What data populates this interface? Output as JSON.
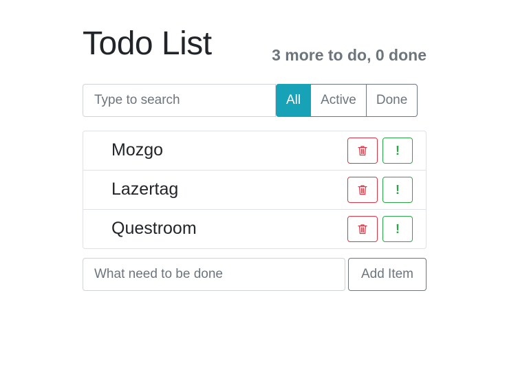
{
  "header": {
    "title": "Todo List",
    "counter": "3 more to do, 0 done"
  },
  "search": {
    "placeholder": "Type to search",
    "value": ""
  },
  "filters": [
    {
      "label": "All",
      "active": true
    },
    {
      "label": "Active",
      "active": false
    },
    {
      "label": "Done",
      "active": false
    }
  ],
  "items": [
    {
      "label": "Mozgo"
    },
    {
      "label": "Lazertag"
    },
    {
      "label": "Questroom"
    }
  ],
  "item_actions": {
    "delete_icon": "trash-icon",
    "important_icon": "exclamation-icon",
    "important_glyph": "!"
  },
  "add_form": {
    "placeholder": "What need to be done",
    "value": "",
    "button_label": "Add Item"
  },
  "colors": {
    "active_filter": "#17a2b8",
    "delete": "#dc3545",
    "important": "#28a745",
    "muted": "#6c757d"
  }
}
